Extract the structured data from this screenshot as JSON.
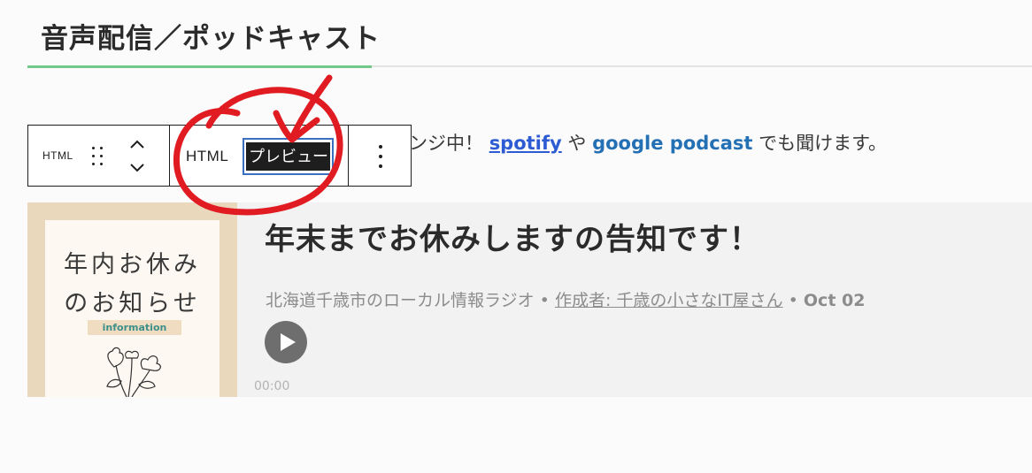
{
  "section": {
    "heading": "音声配信／ポッドキャスト"
  },
  "intro": {
    "lead": "ンジ中！",
    "link_spotify": "spotify",
    "mid": "や",
    "link_google": "google podcast",
    "tail": "でも聞けます。"
  },
  "toolbar": {
    "block_type": "HTML",
    "html_tab": "HTML",
    "preview_tab": "プレビュー"
  },
  "episode": {
    "title": "年末までお休みしますの告知です！",
    "show": "北海道千歳市のローカル情報ラジオ",
    "sep": "•",
    "author": "作成者: 千歳の小さなIT屋さん",
    "date": "Oct 02",
    "time": "00:00",
    "cover": {
      "line1": "年内お休み",
      "line2": "のお知らせ",
      "tag": "information"
    }
  },
  "icons": {
    "drag": "drag-handle-icon",
    "move": "move-up-down-icon",
    "more": "more-options-icon",
    "play": "play-icon"
  },
  "colors": {
    "accent_green": "#72c98a",
    "link_blue": "#2d5bd3",
    "annotation_red": "#e11b22"
  }
}
